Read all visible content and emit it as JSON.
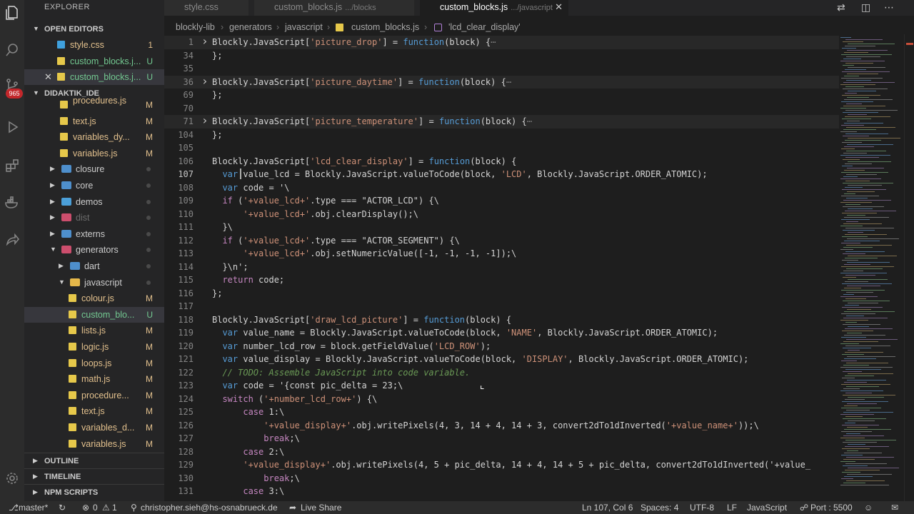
{
  "explorer": {
    "title": "EXPLORER",
    "open_editors_label": "OPEN EDITORS",
    "open_editors": [
      {
        "name": "style.css",
        "status": "1"
      },
      {
        "name": "custom_blocks.j...",
        "status": "U"
      },
      {
        "name": "custom_blocks.j...",
        "status": "U"
      }
    ],
    "project_label": "DIDAKTIK_IDE",
    "tree": [
      {
        "name": "procedures.js",
        "status": "M"
      },
      {
        "name": "text.js",
        "status": "M"
      },
      {
        "name": "variables_dy...",
        "status": "M"
      },
      {
        "name": "variables.js",
        "status": "M"
      },
      {
        "name": "closure",
        "status": ""
      },
      {
        "name": "core",
        "status": ""
      },
      {
        "name": "demos",
        "status": ""
      },
      {
        "name": "dist",
        "status": ""
      },
      {
        "name": "externs",
        "status": ""
      },
      {
        "name": "generators",
        "status": ""
      },
      {
        "name": "dart",
        "status": ""
      },
      {
        "name": "javascript",
        "status": ""
      },
      {
        "name": "colour.js",
        "status": "M"
      },
      {
        "name": "custom_blo...",
        "status": "U"
      },
      {
        "name": "lists.js",
        "status": "M"
      },
      {
        "name": "logic.js",
        "status": "M"
      },
      {
        "name": "loops.js",
        "status": "M"
      },
      {
        "name": "math.js",
        "status": "M"
      },
      {
        "name": "procedure...",
        "status": "M"
      },
      {
        "name": "text.js",
        "status": "M"
      },
      {
        "name": "variables_d...",
        "status": "M"
      },
      {
        "name": "variables.js",
        "status": "M"
      }
    ],
    "outline_label": "OUTLINE",
    "timeline_label": "TIMELINE",
    "npm_label": "NPM SCRIPTS"
  },
  "activity": {
    "badge": "965"
  },
  "tabs": [
    {
      "name": "style.css",
      "sub": ""
    },
    {
      "name": "custom_blocks.js",
      "sub": ".../blocks"
    },
    {
      "name": "custom_blocks.js",
      "sub": ".../javascript"
    }
  ],
  "breadcrumb": [
    "blockly-lib",
    "generators",
    "javascript",
    "custom_blocks.js",
    "'lcd_clear_display'"
  ],
  "status": {
    "branch": "master*",
    "problems": "0",
    "warnings": "1",
    "user": "christopher.sieh@hs-osnabrueck.de",
    "liveshare": "Live Share",
    "position": "Ln 107, Col 6",
    "spaces": "Spaces: 4",
    "encoding": "UTF-8",
    "eol": "LF",
    "language": "JavaScript",
    "port": "Port : 5500"
  },
  "code_lines": [
    {
      "n": "1",
      "fold": ">",
      "text": "Blockly.JavaScript['picture_drop'] = function(block) {⋯"
    },
    {
      "n": "34",
      "fold": "",
      "text": "};"
    },
    {
      "n": "35",
      "fold": "",
      "text": ""
    },
    {
      "n": "36",
      "fold": ">",
      "text": "Blockly.JavaScript['picture_daytime'] = function(block) {⋯"
    },
    {
      "n": "69",
      "fold": "",
      "text": "};"
    },
    {
      "n": "70",
      "fold": "",
      "text": ""
    },
    {
      "n": "71",
      "fold": ">",
      "text": "Blockly.JavaScript['picture_temperature'] = function(block) {⋯"
    },
    {
      "n": "104",
      "fold": "",
      "text": "};"
    },
    {
      "n": "105",
      "fold": "",
      "text": ""
    },
    {
      "n": "106",
      "fold": "",
      "text": "Blockly.JavaScript['lcd_clear_display'] = function(block) {"
    },
    {
      "n": "107",
      "fold": "",
      "text": "  var value_lcd = Blockly.JavaScript.valueToCode(block, 'LCD', Blockly.JavaScript.ORDER_ATOMIC);"
    },
    {
      "n": "108",
      "fold": "",
      "text": "  var code = '\\"
    },
    {
      "n": "109",
      "fold": "",
      "text": "  if ('+value_lcd+'.type === \"ACTOR_LCD\") {\\"
    },
    {
      "n": "110",
      "fold": "",
      "text": "      '+value_lcd+'.obj.clearDisplay();\\"
    },
    {
      "n": "111",
      "fold": "",
      "text": "  }\\"
    },
    {
      "n": "112",
      "fold": "",
      "text": "  if ('+value_lcd+'.type === \"ACTOR_SEGMENT\") {\\"
    },
    {
      "n": "113",
      "fold": "",
      "text": "      '+value_lcd+'.obj.setNumericValue([-1, -1, -1, -1]);\\"
    },
    {
      "n": "114",
      "fold": "",
      "text": "  }\\n';"
    },
    {
      "n": "115",
      "fold": "",
      "text": "  return code;"
    },
    {
      "n": "116",
      "fold": "",
      "text": "};"
    },
    {
      "n": "117",
      "fold": "",
      "text": ""
    },
    {
      "n": "118",
      "fold": "",
      "text": "Blockly.JavaScript['draw_lcd_picture'] = function(block) {"
    },
    {
      "n": "119",
      "fold": "",
      "text": "  var value_name = Blockly.JavaScript.valueToCode(block, 'NAME', Blockly.JavaScript.ORDER_ATOMIC);"
    },
    {
      "n": "120",
      "fold": "",
      "text": "  var number_lcd_row = block.getFieldValue('LCD_ROW');"
    },
    {
      "n": "121",
      "fold": "",
      "text": "  var value_display = Blockly.JavaScript.valueToCode(block, 'DISPLAY', Blockly.JavaScript.ORDER_ATOMIC);"
    },
    {
      "n": "122",
      "fold": "",
      "text": "  // TODO: Assemble JavaScript into code variable."
    },
    {
      "n": "123",
      "fold": "",
      "text": "  var code = '{const pic_delta = 23;\\"
    },
    {
      "n": "124",
      "fold": "",
      "text": "  switch ('+number_lcd_row+') {\\"
    },
    {
      "n": "125",
      "fold": "",
      "text": "      case 1:\\"
    },
    {
      "n": "126",
      "fold": "",
      "text": "          '+value_display+'.obj.writePixels(4, 3, 14 + 4, 14 + 3, convert2dTo1dInverted('+value_name+'));\\"
    },
    {
      "n": "127",
      "fold": "",
      "text": "          break;\\"
    },
    {
      "n": "128",
      "fold": "",
      "text": "      case 2:\\"
    },
    {
      "n": "129",
      "fold": "",
      "text": "      '+value_display+'.obj.writePixels(4, 5 + pic_delta, 14 + 4, 14 + 5 + pic_delta, convert2dTo1dInverted('+value_"
    },
    {
      "n": "130",
      "fold": "",
      "text": "          break;\\"
    },
    {
      "n": "131",
      "fold": "",
      "text": "      case 3:\\"
    }
  ]
}
